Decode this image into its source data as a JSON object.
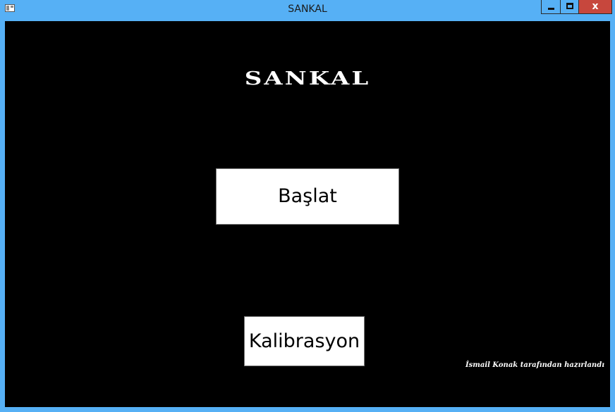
{
  "window": {
    "title": "SANKAL",
    "icon": "app-window-icon",
    "controls": {
      "minimize_icon": "minimize-icon",
      "maximize_icon": "maximize-icon",
      "close_label": "x"
    }
  },
  "main": {
    "brand": "SANKAL",
    "start_button": "Başlat",
    "calibration_button": "Kalibrasyon",
    "credit": "İsmail Konak tarafından hazırlandı"
  },
  "colors": {
    "frame": "#56b0f5",
    "background": "#000000",
    "close_button": "#c7473d",
    "button_face": "#ffffff"
  }
}
